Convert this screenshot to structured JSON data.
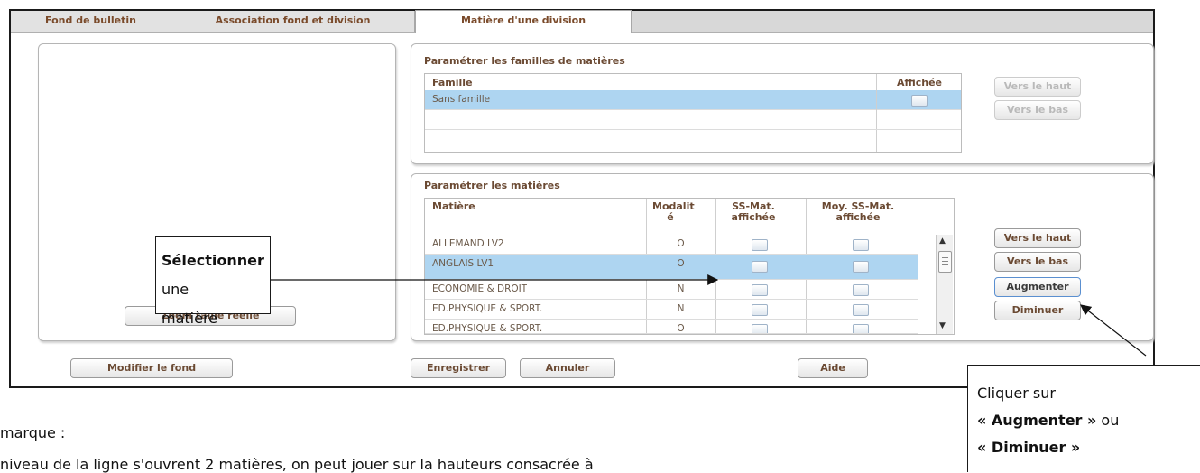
{
  "tabs": [
    {
      "label": "Fond de bulletin"
    },
    {
      "label": "Association fond et division"
    },
    {
      "label": "Matière d'une division"
    }
  ],
  "left_panel": {
    "zoom_button": "Zoom taille réelle"
  },
  "familles": {
    "title": "Paramétrer les familles de matières",
    "col_famille": "Famille",
    "col_affichee": "Affichée",
    "rows": [
      {
        "name": "Sans famille",
        "selected": true
      }
    ],
    "btn_up": "Vers le haut",
    "btn_down": "Vers le bas"
  },
  "matieres": {
    "title": "Paramétrer les matières",
    "col_matiere": "Matière",
    "col_modalite": "Modalit é",
    "col_ssmat": "SS-Mat. affichée",
    "col_moy": "Moy. SS-Mat. affichée",
    "rows": [
      {
        "name": "ALLEMAND LV2",
        "mod": "O"
      },
      {
        "name": "ANGLAIS LV1",
        "mod": "O"
      },
      {
        "name": "ECONOMIE & DROIT",
        "mod": "N"
      },
      {
        "name": "ED.PHYSIQUE & SPORT.",
        "mod": "N"
      },
      {
        "name": "ED.PHYSIQUE & SPORT.",
        "mod": "O"
      }
    ],
    "btn_up": "Vers le haut",
    "btn_down": "Vers le bas",
    "btn_augmenter": "Augmenter",
    "btn_diminuer": "Diminuer"
  },
  "bottom": {
    "modifier": "Modifier le fond",
    "enregistrer": "Enregistrer",
    "annuler": "Annuler",
    "aide": "Aide"
  },
  "callout_select": {
    "bold": "Sélectionner",
    "rest": " une",
    "line2": "matière"
  },
  "callout_click": {
    "line1": "Cliquer sur",
    "line2_bold": "« Augmenter »",
    "line2_rest": " ou",
    "line3_bold": "« Diminuer »"
  },
  "page_text": {
    "line1": "marque :",
    "line2": "niveau de la ligne s'ouvrent 2 matières, on peut jouer sur la hauteurs consacrée à"
  }
}
